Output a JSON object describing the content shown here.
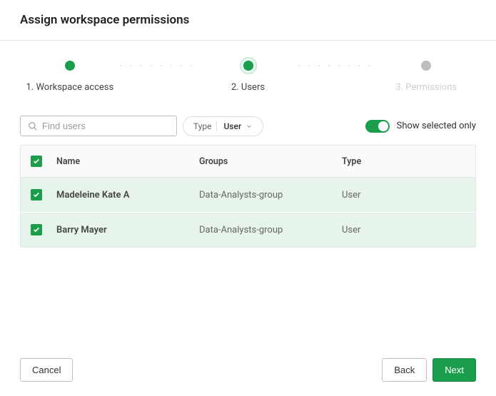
{
  "title": "Assign workspace permissions",
  "stepper": {
    "steps": [
      {
        "label": "1. Workspace access",
        "state": "done"
      },
      {
        "label": "2. Users",
        "state": "active"
      },
      {
        "label": "3. Permissions",
        "state": "inactive"
      }
    ]
  },
  "search": {
    "placeholder": "Find users"
  },
  "type_filter": {
    "label": "Type",
    "value": "User"
  },
  "toggle": {
    "label": "Show selected only",
    "on": true
  },
  "table": {
    "columns": {
      "name": "Name",
      "groups": "Groups",
      "type": "Type"
    },
    "rows": [
      {
        "selected": true,
        "name": "Madeleine Kate A",
        "groups": "Data-Analysts-group",
        "type": "User"
      },
      {
        "selected": true,
        "name": "Barry Mayer",
        "groups": "Data-Analysts-group",
        "type": "User"
      }
    ]
  },
  "footer": {
    "cancel": "Cancel",
    "back": "Back",
    "next": "Next"
  }
}
